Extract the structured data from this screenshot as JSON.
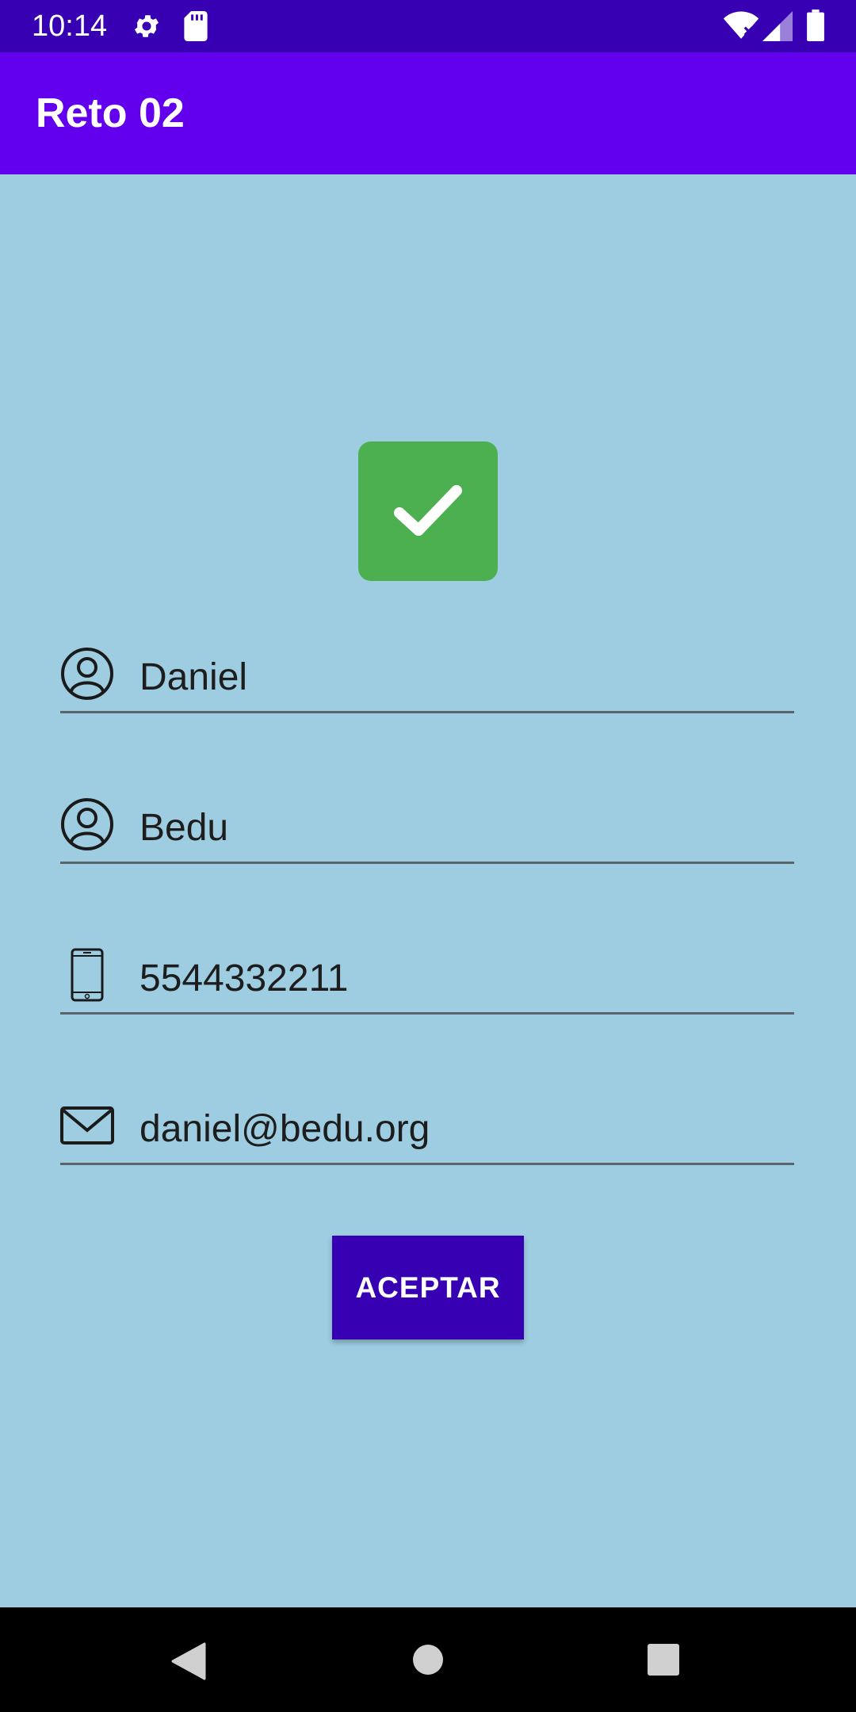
{
  "status_bar": {
    "time": "10:14",
    "icons": [
      "gear-icon",
      "sd-card-icon",
      "wifi-icon",
      "signal-icon",
      "battery-icon"
    ]
  },
  "app_bar": {
    "title": "Reto 02"
  },
  "check": {
    "icon": "check-icon",
    "color": "#4CAF50"
  },
  "form": {
    "first_name": {
      "value": "Daniel",
      "icon": "person-icon"
    },
    "last_name": {
      "value": "Bedu",
      "icon": "person-icon"
    },
    "phone": {
      "value": "5544332211",
      "icon": "phone-icon"
    },
    "email": {
      "value": "daniel@bedu.org",
      "icon": "email-icon"
    }
  },
  "accept_button": {
    "label": "ACEPTAR",
    "color": "#3700B3"
  },
  "nav_bar": {
    "icons": [
      "back-icon",
      "home-icon",
      "recents-icon"
    ]
  },
  "colors": {
    "status_bar": "#3700B3",
    "app_bar": "#6200EE",
    "background": "#9ECDE1"
  }
}
